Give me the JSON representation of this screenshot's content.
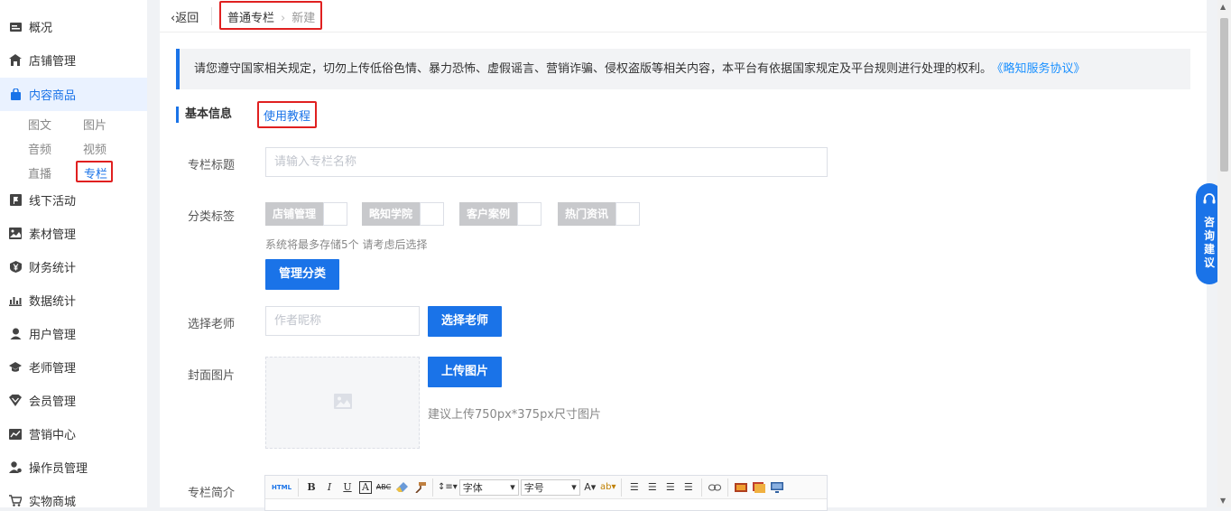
{
  "sidebar": {
    "items": [
      {
        "label": "概况",
        "icon": "overview-icon"
      },
      {
        "label": "店铺管理",
        "icon": "store-icon"
      },
      {
        "label": "内容商品",
        "icon": "bag-icon"
      },
      {
        "label": "线下活动",
        "icon": "flag-icon"
      },
      {
        "label": "素材管理",
        "icon": "image-icon"
      },
      {
        "label": "财务统计",
        "icon": "yen-icon"
      },
      {
        "label": "数据统计",
        "icon": "bar-chart-icon"
      },
      {
        "label": "用户管理",
        "icon": "user-icon"
      },
      {
        "label": "老师管理",
        "icon": "graduation-cap-icon"
      },
      {
        "label": "会员管理",
        "icon": "vip-icon"
      },
      {
        "label": "营销中心",
        "icon": "trend-icon"
      },
      {
        "label": "操作员管理",
        "icon": "operator-icon"
      },
      {
        "label": "实物商城",
        "icon": "cart-icon"
      }
    ],
    "sub_items": [
      "图文",
      "图片",
      "音频",
      "视频",
      "直播",
      "专栏"
    ]
  },
  "topbar": {
    "back_label": "返回",
    "back_icon": "chevron-left-icon",
    "crumb_1": "普通专栏",
    "crumb_sep": "›",
    "crumb_2": "新建"
  },
  "notice": {
    "text": "请您遵守国家相关规定，切勿上传低俗色情、暴力恐怖、虚假谣言、营销诈骗、侵权盗版等相关内容，本平台有依据国家规定及平台规则进行处理的权利。",
    "link": "《略知服务协议》"
  },
  "section": {
    "title": "基本信息",
    "tutorial_link": "使用教程"
  },
  "form": {
    "title_label": "专栏标题",
    "title_placeholder": "请输入专栏名称",
    "category_label": "分类标签",
    "tags": [
      "店铺管理",
      "略知学院",
      "客户案例",
      "热门资讯"
    ],
    "category_hint": "系统将最多存储5个 请考虑后选择",
    "manage_category_button": "管理分类",
    "teacher_label": "选择老师",
    "teacher_placeholder": "作者昵称",
    "select_teacher_button": "选择老师",
    "cover_label": "封面图片",
    "upload_button": "上传图片",
    "cover_hint": "建议上传750px*375px尺寸图片",
    "intro_label": "专栏简介"
  },
  "editor": {
    "html_label": "HTML",
    "font_select": "字体",
    "size_select": "字号"
  },
  "consult": {
    "label": "咨询建议"
  },
  "colors": {
    "accent": "#1a73e8",
    "highlight_box": "#e02020"
  }
}
